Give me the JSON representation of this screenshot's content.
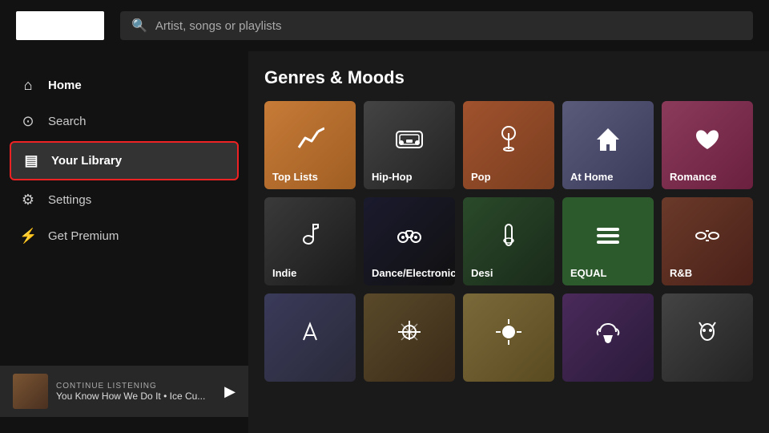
{
  "header": {
    "search_placeholder": "Artist, songs or playlists"
  },
  "sidebar": {
    "items": [
      {
        "id": "home",
        "label": "Home",
        "icon": "⌂"
      },
      {
        "id": "search",
        "label": "Search",
        "icon": "⊙"
      },
      {
        "id": "your-library",
        "label": "Your Library",
        "icon": "▤",
        "highlighted": true
      },
      {
        "id": "settings",
        "label": "Settings",
        "icon": "⚙"
      },
      {
        "id": "get-premium",
        "label": "Get Premium",
        "icon": "⚡"
      }
    ],
    "continue_label": "CONTINUE LISTENING",
    "continue_song": "You Know How We Do It • Ice Cu..."
  },
  "main": {
    "section_title": "Genres & Moods",
    "genres": [
      {
        "id": "top-lists",
        "label": "Top Lists",
        "icon": "📈",
        "class": "gc-toplists"
      },
      {
        "id": "hip-hop",
        "label": "Hip-Hop",
        "icon": "📻",
        "class": "gc-hiphop"
      },
      {
        "id": "pop",
        "label": "Pop",
        "icon": "🎤",
        "class": "gc-pop"
      },
      {
        "id": "at-home",
        "label": "At Home",
        "icon": "🏠",
        "class": "gc-athome"
      },
      {
        "id": "romance",
        "label": "Romance",
        "icon": "♥",
        "class": "gc-romance"
      },
      {
        "id": "indie",
        "label": "Indie",
        "icon": "🎸",
        "class": "gc-indie"
      },
      {
        "id": "dance-electronic",
        "label": "Dance/Electronic",
        "icon": "🎛",
        "class": "gc-dance"
      },
      {
        "id": "desi",
        "label": "Desi",
        "icon": "🎸",
        "class": "gc-desi"
      },
      {
        "id": "equal",
        "label": "EQUAL",
        "icon": "≡",
        "class": "gc-equal"
      },
      {
        "id": "rnb",
        "label": "R&B",
        "icon": "👓",
        "class": "gc-rnb"
      },
      {
        "id": "row3a",
        "label": "",
        "icon": "",
        "class": "gc-row3a"
      },
      {
        "id": "row3b",
        "label": "",
        "icon": "🌅",
        "class": "gc-row3b"
      },
      {
        "id": "row3c",
        "label": "",
        "icon": "☀",
        "class": "gc-row3c"
      },
      {
        "id": "row3d",
        "label": "",
        "icon": "🤲",
        "class": "gc-row3d"
      },
      {
        "id": "row3e",
        "label": "",
        "icon": "🐱",
        "class": "gc-hiphop"
      }
    ]
  }
}
